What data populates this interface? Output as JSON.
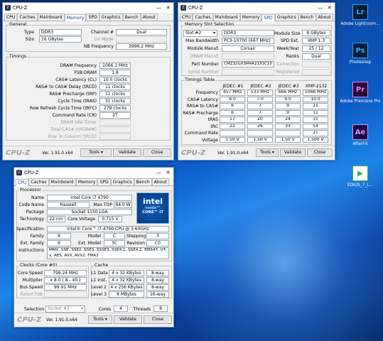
{
  "desktop": {
    "icons": [
      {
        "label": "Adobe Lightroom...",
        "glyph": "Lr",
        "bg": "#001d34",
        "fg": "#31a8ff"
      },
      {
        "label": "Photoshop",
        "glyph": "Ps",
        "bg": "#001e36",
        "fg": "#31a8ff"
      },
      {
        "label": "Adobe Premiere Pro",
        "glyph": "Pr",
        "bg": "#2a0634",
        "fg": "#e77bff"
      },
      {
        "label": "AfterFX",
        "glyph": "Ae",
        "bg": "#1f0040",
        "fg": "#d291ff"
      },
      {
        "label": "EDIUS_7_L...",
        "glyph": "▶",
        "bg": "#ffffff",
        "fg": "#27b24a"
      }
    ]
  },
  "common": {
    "title": "CPU-Z",
    "logo": "CPU-Z",
    "version": "Ver. 1.91.0.x64",
    "tools": "Tools",
    "validate": "Validate",
    "close": "Close",
    "minimize": "—",
    "closeglyph": "✕",
    "tabs": [
      "CPU",
      "Caches",
      "Mainboard",
      "Memory",
      "SPD",
      "Graphics",
      "Bench",
      "About"
    ]
  },
  "memory": {
    "general_title": "General",
    "type_label": "Type",
    "type": "DDR3",
    "channel_label": "Channel #",
    "channel": "Dual",
    "size_label": "Size",
    "size": "16 GBytes",
    "dc_label": "DC Mode",
    "nb_label": "NB Frequency",
    "nb": "3996.2 MHz",
    "timings_title": "Timings",
    "rows": [
      {
        "l": "DRAM Frequency",
        "v": "1066.1 MHz",
        "dim": false
      },
      {
        "l": "FSB:DRAM",
        "v": "1:8",
        "dim": false
      },
      {
        "l": "CAS# Latency (CL)",
        "v": "10.0 clocks",
        "dim": false
      },
      {
        "l": "RAS# to CAS# Delay (tRCD)",
        "v": "11 clocks",
        "dim": false
      },
      {
        "l": "RAS# Precharge (tRP)",
        "v": "11 clocks",
        "dim": false
      },
      {
        "l": "Cycle Time (tRAS)",
        "v": "31 clocks",
        "dim": false
      },
      {
        "l": "Row Refresh Cycle Time (tRFC)",
        "v": "278 clocks",
        "dim": false
      },
      {
        "l": "Command Rate (CR)",
        "v": "2T",
        "dim": false
      },
      {
        "l": "DRAM Idle Timer",
        "v": "",
        "dim": true
      },
      {
        "l": "Total CAS# (tRDRAM)",
        "v": "",
        "dim": true
      },
      {
        "l": "Row To Column (tRCD)",
        "v": "",
        "dim": true
      }
    ]
  },
  "spd": {
    "slot_title": "Memory Slot Selection",
    "slot": "Slot #2",
    "slot_type": "DDR3",
    "module_size_label": "Module Size",
    "module_size": "8 GBytes",
    "max_bw_label": "Max Bandwidth",
    "max_bw": "PC3-10700 (667 MHz)",
    "spd_ext_label": "SPD Ext.",
    "spd_ext": "XMP 1.3",
    "manuf_label": "Module Manuf.",
    "manuf": "Corsair",
    "week_label": "Week/Year",
    "week": "25 / 12",
    "dram_label": "DRAM Manuf.",
    "ranks_label": "Ranks",
    "ranks": "Dual",
    "part_label": "Part Number",
    "part": "CMZ32GX3M4A2133C10",
    "correction_label": "Correction",
    "serial_label": "Serial Number",
    "registered_label": "Registered",
    "table_title": "Timings Table",
    "cols": [
      "JEDEC #1",
      "JEDEC #2",
      "JEDEC #3",
      "XMP-2132"
    ],
    "rows": [
      {
        "l": "Frequency",
        "v": [
          "457 MHz",
          "533 MHz",
          "666 MHz",
          "1066 MHz"
        ]
      },
      {
        "l": "CAS# Latency",
        "v": [
          "6.0",
          "7.0",
          "9.0",
          "10.0"
        ]
      },
      {
        "l": "RAS# to CAS#",
        "v": [
          "6",
          "7",
          "9",
          "11"
        ]
      },
      {
        "l": "RAS# Precharge",
        "v": [
          "6",
          "7",
          "9",
          "11"
        ]
      },
      {
        "l": "tRAS",
        "v": [
          "17",
          "20",
          "24",
          "31"
        ]
      },
      {
        "l": "tRC",
        "v": [
          "22",
          "26",
          "33",
          "54"
        ]
      },
      {
        "l": "Command Rate",
        "v": [
          "",
          "",
          "",
          "2T"
        ]
      },
      {
        "l": "Voltage",
        "v": [
          "1.50 V",
          "1.50 V",
          "1.50 V",
          "1.500 V"
        ]
      }
    ]
  },
  "cpu": {
    "proc_title": "Processor",
    "name_label": "Name",
    "name": "Intel Core i7 4790",
    "code_label": "Code Name",
    "code": "Haswell",
    "tdp_label": "Max TDP",
    "tdp": "84.0 W",
    "pkg_label": "Package",
    "pkg": "Socket 1150 LGA",
    "tech_label": "Technology",
    "tech": "22 nm",
    "cv_label": "Core Voltage",
    "cv": "0.715 V",
    "spec_label": "Specification",
    "spec": "Intel® Core™ i7-4790 CPU @ 3.60GHz",
    "family_label": "Family",
    "family": "6",
    "model_label": "Model",
    "model": "C",
    "stepping_label": "Stepping",
    "stepping": "3",
    "extfam_label": "Ext. Family",
    "extfam": "6",
    "extmodel_label": "Ext. Model",
    "extmodel": "3C",
    "rev_label": "Revision",
    "rev": "C0",
    "instr_label": "Instructions",
    "instr": "MMX, SSE, SSE2, SSE3, SSSE3, SSE4.1, SSE4.2, EM64T, VT-x, AES, AVX, AVX2, FMA3",
    "clocks_title": "Clocks (Core #0)",
    "cs_label": "Core Speed",
    "cs": "799.24 MHz",
    "mult_label": "Multiplier",
    "mult": "x 8.0 ( 8 - 40 )",
    "bus_label": "Bus Speed",
    "bus": "99.91 MHz",
    "fsb_label": "Rated FSB",
    "cache_title": "Cache",
    "cache": [
      {
        "l": "L1 Data",
        "v": "4 x 32 KBytes",
        "w": "8-way"
      },
      {
        "l": "L1 Inst.",
        "v": "4 x 32 KBytes",
        "w": "8-way"
      },
      {
        "l": "Level 2",
        "v": "4 x 256 KBytes",
        "w": "8-way"
      },
      {
        "l": "Level 3",
        "v": "8 MBytes",
        "w": "16-way"
      }
    ],
    "selection_label": "Selection",
    "selection": "Socket #1",
    "cores_label": "Cores",
    "cores": "4",
    "threads_label": "Threads",
    "threads": "8",
    "intel_brand": "intel",
    "intel_inside": "inside™",
    "intel_core": "CORE™ i7"
  }
}
